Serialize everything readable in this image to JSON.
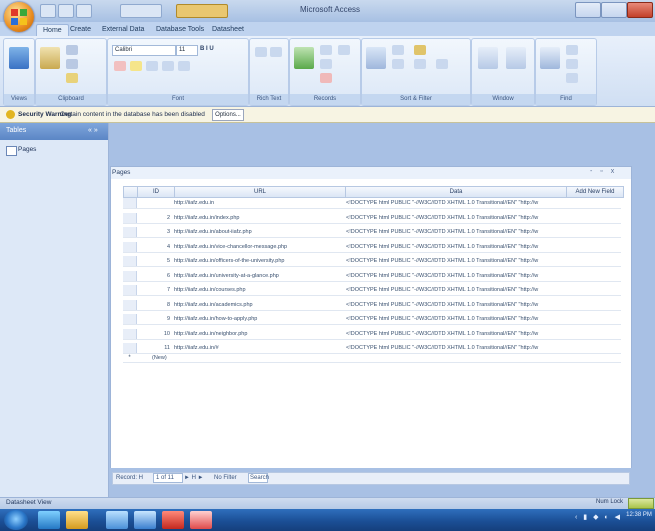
{
  "window": {
    "title": "Microsoft Access"
  },
  "ribbon": {
    "tabs": [
      "Home",
      "Create",
      "External Data",
      "Database Tools",
      "Datasheet"
    ],
    "groups": [
      "Views",
      "Clipboard",
      "Font",
      "Rich Text",
      "Records",
      "Sort & Filter",
      "Window",
      "Find"
    ],
    "font_name": "Calibri",
    "font_size": "11"
  },
  "message_bar": {
    "label": "Security Warning",
    "text": "Certain content in the database has been disabled",
    "button": "Options..."
  },
  "nav_pane": {
    "header": "Tables",
    "header_buttons": "« »",
    "items": [
      "Pages"
    ]
  },
  "document": {
    "tab_label": "Pages",
    "window_controls": "- ▫ x"
  },
  "table": {
    "columns": [
      "ID",
      "URL",
      "Data",
      "Add New Field"
    ],
    "rows": [
      {
        "id": "",
        "url": "http://iiafz.edu.in",
        "data": "<!DOCTYPE html PUBLIC \"-//W3C//DTD XHTML 1.0 Transitional//EN\" \"http://w"
      },
      {
        "id": "2",
        "url": "http://iiafz.edu.in/index.php",
        "data": "<!DOCTYPE html PUBLIC \"-//W3C//DTD XHTML 1.0 Transitional//EN\" \"http://w"
      },
      {
        "id": "3",
        "url": "http://iiafz.edu.in/about-iiafz.php",
        "data": "<!DOCTYPE html PUBLIC \"-//W3C//DTD XHTML 1.0 Transitional//EN\" \"http://w"
      },
      {
        "id": "4",
        "url": "http://iiafz.edu.in/vice-chancellor-message.php",
        "data": "<!DOCTYPE html PUBLIC \"-//W3C//DTD XHTML 1.0 Transitional//EN\" \"http://w"
      },
      {
        "id": "5",
        "url": "http://iiafz.edu.in/officers-of-the-university.php",
        "data": "<!DOCTYPE html PUBLIC \"-//W3C//DTD XHTML 1.0 Transitional//EN\" \"http://w"
      },
      {
        "id": "6",
        "url": "http://iiafz.edu.in/university-at-a-glance.php",
        "data": "<!DOCTYPE html PUBLIC \"-//W3C//DTD XHTML 1.0 Transitional//EN\" \"http://w"
      },
      {
        "id": "7",
        "url": "http://iiafz.edu.in/courses.php",
        "data": "<!DOCTYPE html PUBLIC \"-//W3C//DTD XHTML 1.0 Transitional//EN\" \"http://w"
      },
      {
        "id": "8",
        "url": "http://iiafz.edu.in/academics.php",
        "data": "<!DOCTYPE html PUBLIC \"-//W3C//DTD XHTML 1.0 Transitional//EN\" \"http://w"
      },
      {
        "id": "9",
        "url": "http://iiafz.edu.in/how-to-apply.php",
        "data": "<!DOCTYPE html PUBLIC \"-//W3C//DTD XHTML 1.0 Transitional//EN\" \"http://w"
      },
      {
        "id": "10",
        "url": "http://iiafz.edu.in/neighbor.php",
        "data": "<!DOCTYPE html PUBLIC \"-//W3C//DTD XHTML 1.0 Transitional//EN\" \"http://w"
      },
      {
        "id": "11",
        "url": "http://iiafz.edu.in/#",
        "data": "<!DOCTYPE html PUBLIC \"-//W3C//DTD XHTML 1.0 Transitional//EN\" \"http://w"
      }
    ],
    "new_row": {
      "marker": "*",
      "id": "(New)"
    }
  },
  "record_nav": {
    "label": "Record: H",
    "position": "1 of 11",
    "arrows": "► H ►",
    "filter": "No Filter",
    "search": "Search"
  },
  "status_bar": {
    "text": "Datasheet View",
    "right": "Num Lock"
  },
  "taskbar": {
    "tray": "‹ ▮ ◆ ◐ ◀",
    "clock": "12:38 PM"
  },
  "colors": {
    "ribbon_blue": "#d0dff3",
    "workspace": "#a8c0e4",
    "taskbar": "#1b4f96"
  }
}
